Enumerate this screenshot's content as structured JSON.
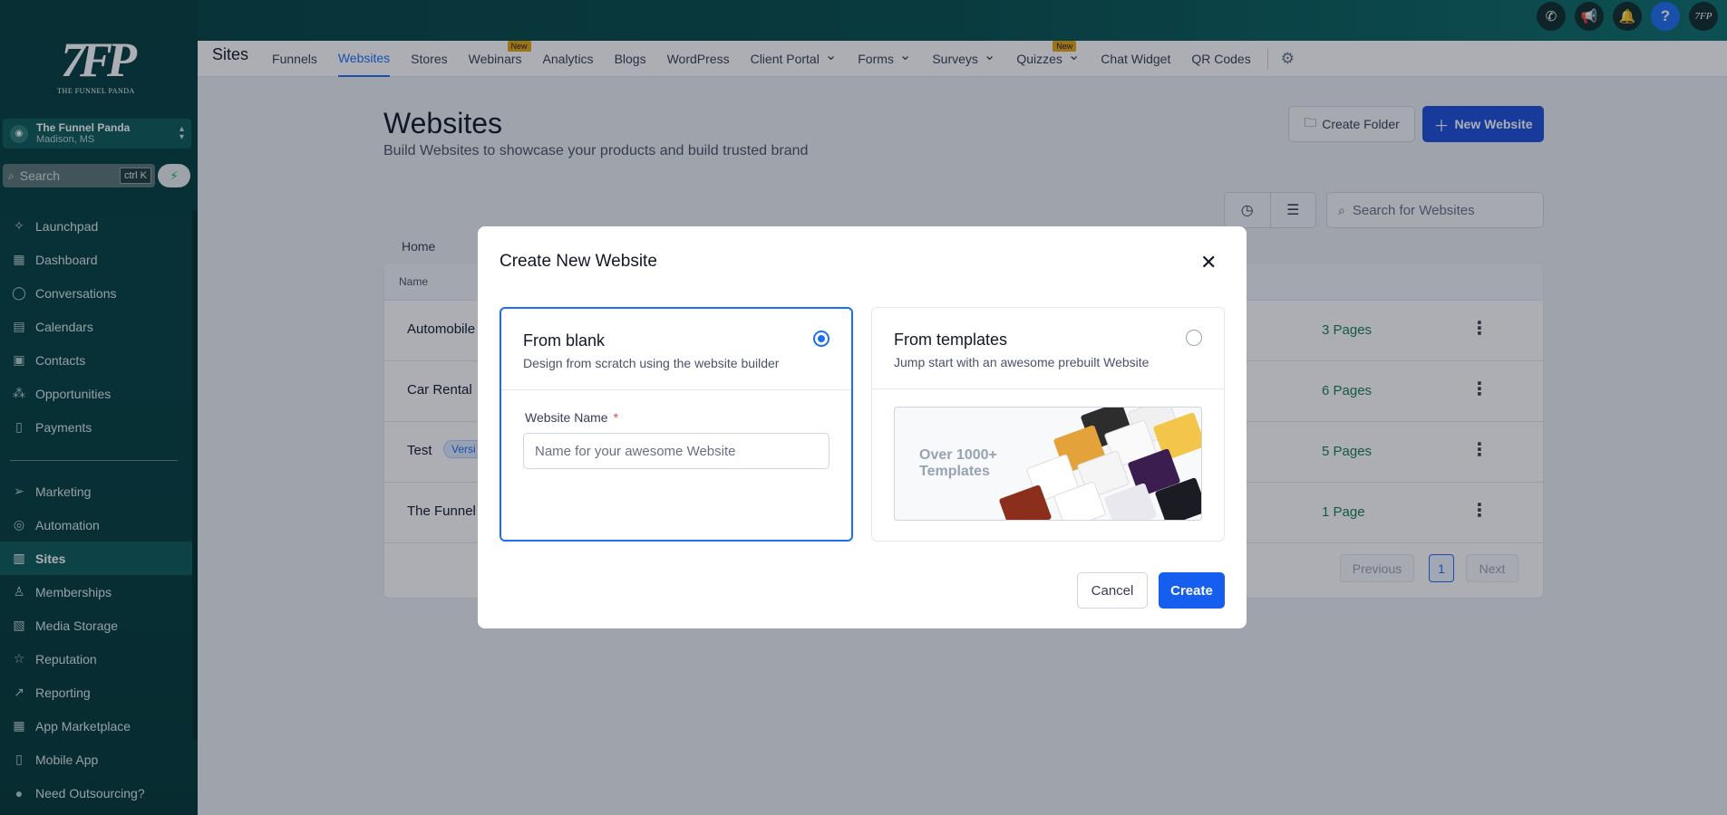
{
  "topbar": {
    "icons": [
      "phone-icon",
      "megaphone-icon",
      "bell-icon",
      "help-icon",
      "avatar"
    ],
    "help_label": "?"
  },
  "sidebar": {
    "logo_mark": "7FP",
    "logo_text": "THE FUNNEL PANDA",
    "account": {
      "name": "The Funnel Panda",
      "location": "Madison, MS"
    },
    "search": {
      "placeholder": "Search",
      "shortcut": "ctrl K"
    },
    "items_top": [
      {
        "label": "Launchpad",
        "icon": "rocket-icon",
        "glyph": "✧"
      },
      {
        "label": "Dashboard",
        "icon": "grid-icon",
        "glyph": "▦"
      },
      {
        "label": "Conversations",
        "icon": "chat-icon",
        "glyph": "◯"
      },
      {
        "label": "Calendars",
        "icon": "calendar-icon",
        "glyph": "▤"
      },
      {
        "label": "Contacts",
        "icon": "contacts-icon",
        "glyph": "▣"
      },
      {
        "label": "Opportunities",
        "icon": "opportunities-icon",
        "glyph": "⁂"
      },
      {
        "label": "Payments",
        "icon": "payments-icon",
        "glyph": "▯"
      }
    ],
    "items_bottom": [
      {
        "label": "Marketing",
        "icon": "send-icon",
        "glyph": "➢"
      },
      {
        "label": "Automation",
        "icon": "automation-icon",
        "glyph": "◎"
      },
      {
        "label": "Sites",
        "icon": "sites-icon",
        "glyph": "▥",
        "active": true
      },
      {
        "label": "Memberships",
        "icon": "memberships-icon",
        "glyph": "♙"
      },
      {
        "label": "Media Storage",
        "icon": "image-icon",
        "glyph": "▧"
      },
      {
        "label": "Reputation",
        "icon": "star-icon",
        "glyph": "☆"
      },
      {
        "label": "Reporting",
        "icon": "trend-icon",
        "glyph": "↗"
      },
      {
        "label": "App Marketplace",
        "icon": "apps-icon",
        "glyph": "▦"
      },
      {
        "label": "Mobile App",
        "icon": "mobile-icon",
        "glyph": "▯"
      },
      {
        "label": "Need Outsourcing?",
        "icon": "person-icon",
        "glyph": "●"
      }
    ]
  },
  "subnav": {
    "title": "Sites",
    "tabs": [
      {
        "label": "Funnels"
      },
      {
        "label": "Websites",
        "active": true
      },
      {
        "label": "Stores"
      },
      {
        "label": "Webinars",
        "badge": "New"
      },
      {
        "label": "Analytics"
      },
      {
        "label": "Blogs"
      },
      {
        "label": "WordPress"
      },
      {
        "label": "Client Portal",
        "dropdown": true
      },
      {
        "label": "Forms",
        "dropdown": true
      },
      {
        "label": "Surveys",
        "dropdown": true
      },
      {
        "label": "Quizzes",
        "dropdown": true,
        "badge": "New"
      },
      {
        "label": "Chat Widget"
      },
      {
        "label": "QR Codes"
      }
    ]
  },
  "page": {
    "title": "Websites",
    "subtitle": "Build Websites to showcase your products and build trusted brand",
    "create_folder": "Create Folder",
    "new_website": "New Website",
    "search_placeholder": "Search for Websites",
    "breadcrumb": "Home",
    "table": {
      "col_name": "Name",
      "rows": [
        {
          "name": "Automobile",
          "pages": "3 Pages"
        },
        {
          "name": "Car Rental",
          "pages": "6 Pages"
        },
        {
          "name": "Test",
          "badge": "Versi",
          "pages": "5 Pages"
        },
        {
          "name": "The Funnel",
          "pages": "1 Page"
        }
      ]
    },
    "pagination": {
      "previous": "Previous",
      "current": "1",
      "next": "Next"
    }
  },
  "modal": {
    "title": "Create New Website",
    "blank": {
      "title": "From blank",
      "desc": "Design from scratch using the website builder",
      "selected": true
    },
    "field": {
      "label": "Website Name",
      "required_mark": "*",
      "placeholder": "Name for your awesome Website",
      "value": ""
    },
    "templates": {
      "title": "From templates",
      "desc": "Jump start with an awesome prebuilt Website",
      "banner": "Over 1000+ Templates"
    },
    "cancel": "Cancel",
    "create": "Create"
  },
  "colors": {
    "sidebar": "#02403f",
    "accent": "#1d6ff2",
    "primary_button": "#155eef",
    "badge": "#e6a60c"
  }
}
